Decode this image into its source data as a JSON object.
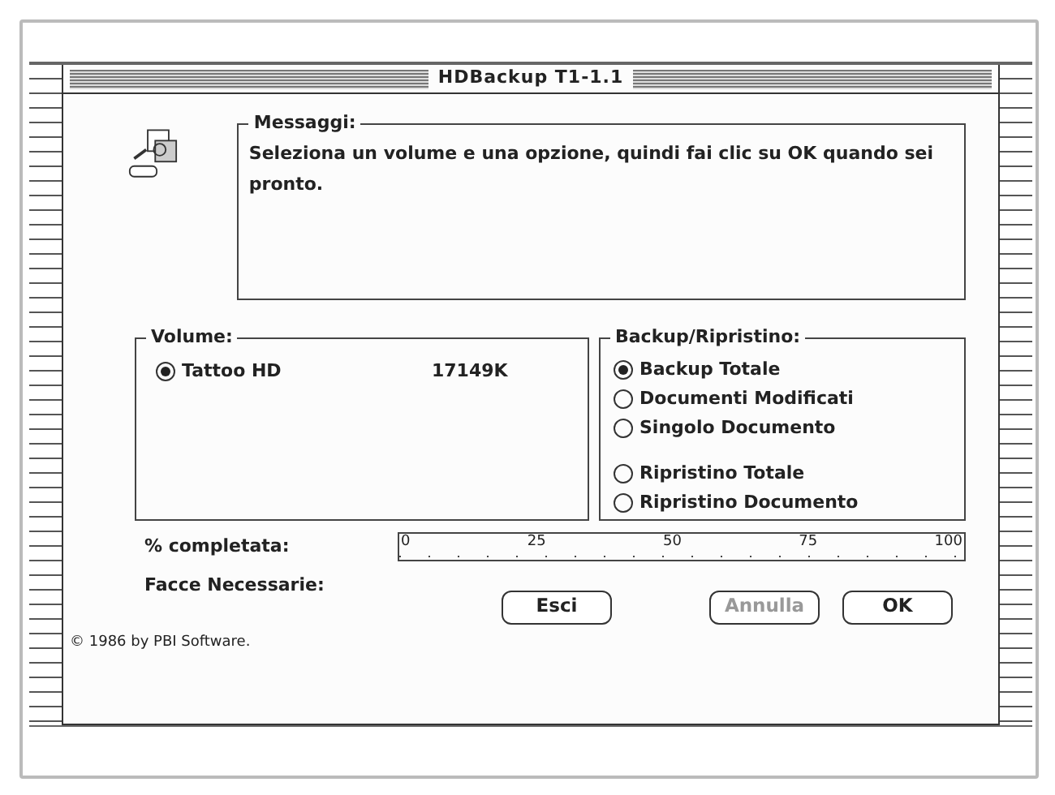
{
  "window": {
    "title": "HDBackup  T1-1.1"
  },
  "messages": {
    "label": "Messaggi:",
    "text": "Seleziona un volume e una opzione, quindi fai clic su OK quando sei pronto."
  },
  "volume": {
    "label": "Volume:",
    "items": [
      {
        "name": "Tattoo HD",
        "size": "17149K",
        "selected": true
      }
    ]
  },
  "backup": {
    "label": "Backup/Ripristino:",
    "groups": [
      [
        {
          "label": "Backup Totale",
          "selected": true
        },
        {
          "label": "Documenti Modificati",
          "selected": false
        },
        {
          "label": "Singolo Documento",
          "selected": false
        }
      ],
      [
        {
          "label": "Ripristino Totale",
          "selected": false
        },
        {
          "label": "Ripristino Documento",
          "selected": false
        }
      ]
    ]
  },
  "progress": {
    "label": "% completata:",
    "ticks": [
      "0",
      "25",
      "50",
      "75",
      "100"
    ]
  },
  "sides": {
    "label": "Facce Necessarie:"
  },
  "buttons": [
    {
      "label": "Esci",
      "disabled": false
    },
    {
      "label": "Annulla",
      "disabled": true
    },
    {
      "label": "OK",
      "disabled": false
    }
  ],
  "copyright": "© 1986 by PBI Software."
}
